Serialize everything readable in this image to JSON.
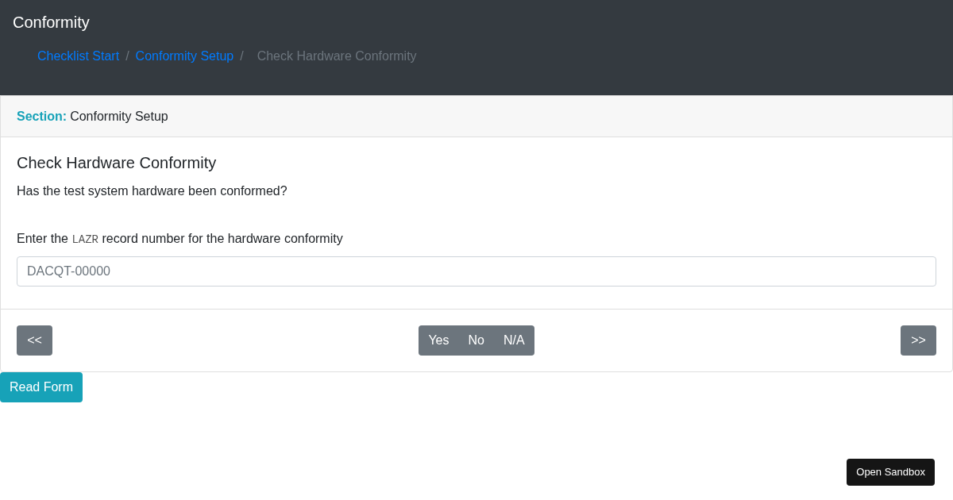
{
  "header": {
    "title": "Conformity",
    "breadcrumb": [
      {
        "label": "Checklist Start",
        "kind": "link"
      },
      {
        "label": "Conformity Setup",
        "kind": "link",
        "separator": "/"
      },
      {
        "label": "Check Hardware Conformity",
        "kind": "current",
        "separator": "/"
      }
    ]
  },
  "card": {
    "section_label": "Section:",
    "section_name": "Conformity Setup",
    "title": "Check Hardware Conformity",
    "question": "Has the test system hardware been conformed?",
    "field_label": {
      "before": "Enter the",
      "code": "LAZR",
      "after": "record number for the hardware conformity"
    },
    "field": {
      "placeholder": "DACQT-00000"
    },
    "prev_button": "<<",
    "answers": [
      "Yes",
      "No",
      "N/A"
    ],
    "next_button": ">>"
  },
  "read_form_button": "Read Form",
  "sandbox_button": "Open Sandbox"
}
